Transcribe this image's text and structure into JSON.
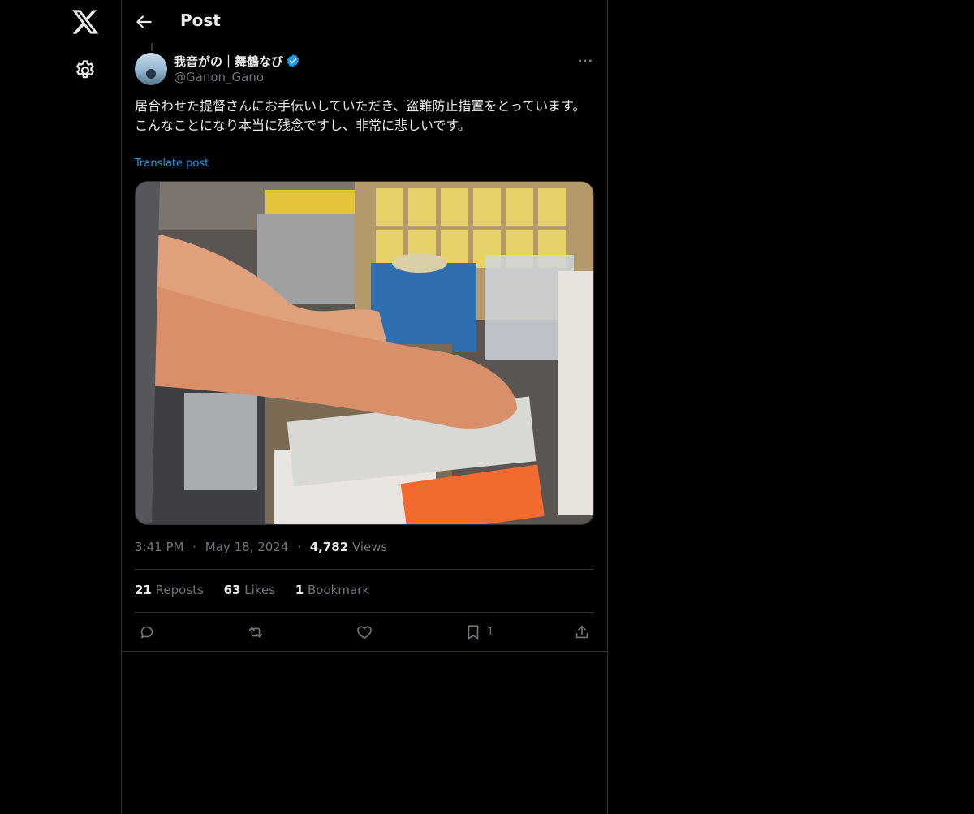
{
  "header": {
    "title": "Post"
  },
  "author": {
    "name": "我音がの｜舞鶴なび",
    "handle": "@Ganon_Gano"
  },
  "post": {
    "text": "居合わせた提督さんにお手伝いしていただき、盗難防止措置をとっています。\nこんなことになり本当に残念ですし、非常に悲しいです。",
    "translate_label": "Translate post"
  },
  "meta": {
    "time": "3:41 PM",
    "dot1": "·",
    "date": "May 18, 2024",
    "dot2": "·",
    "views_count": "4,782",
    "views_label": "Views"
  },
  "stats": {
    "reposts_count": "21",
    "reposts_label": "Reposts",
    "likes_count": "63",
    "likes_label": "Likes",
    "bookmarks_count": "1",
    "bookmarks_label": "Bookmark"
  },
  "actions": {
    "bookmark_count": "1"
  },
  "icons": [
    "x-logo-icon",
    "settings-gear-icon",
    "back-arrow-icon",
    "verified-badge-icon",
    "more-icon",
    "reply-icon",
    "repost-icon",
    "like-icon",
    "bookmark-icon",
    "share-icon"
  ],
  "colors": {
    "background": "#000000",
    "text": "#e7e9ea",
    "muted": "#71767b",
    "accent": "#1d9bf0",
    "border": "#2f3336"
  }
}
